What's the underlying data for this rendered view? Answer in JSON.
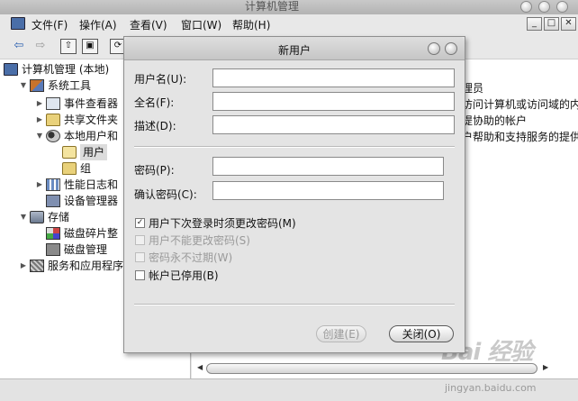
{
  "window": {
    "title": "计算机管理",
    "controls": [
      "_",
      "□",
      "✕"
    ]
  },
  "menu": [
    {
      "label": "文件(F)"
    },
    {
      "label": "操作(A)"
    },
    {
      "label": "查看(V)"
    },
    {
      "label": "窗口(W)"
    },
    {
      "label": "帮助(H)"
    }
  ],
  "toolbar": {
    "back": "⇦",
    "forward": "⇨",
    "up": "⇧",
    "showhide": "▣",
    "refresh": "⟳"
  },
  "tree": {
    "items": [
      {
        "label": "计算机管理 (本地)",
        "expander": ""
      },
      {
        "label": "系统工具",
        "expander": "▼"
      },
      {
        "label": "事件查看器",
        "expander": "▶"
      },
      {
        "label": "共享文件夹",
        "expander": "▶"
      },
      {
        "label": "本地用户和",
        "expander": "▼"
      },
      {
        "label": "用户",
        "expander": ""
      },
      {
        "label": "组",
        "expander": ""
      },
      {
        "label": "性能日志和",
        "expander": "▶"
      },
      {
        "label": "设备管理器",
        "expander": ""
      },
      {
        "label": "存储",
        "expander": "▼"
      },
      {
        "label": "磁盘碎片整",
        "expander": ""
      },
      {
        "label": "磁盘管理",
        "expander": ""
      },
      {
        "label": "服务和应用程序",
        "expander": "▶"
      }
    ]
  },
  "right_pane": {
    "lines": [
      "理员",
      "访问计算机或访问域的内",
      "提协助的帐户",
      "户帮助和支持服务的提供"
    ]
  },
  "dialog": {
    "title": "新用户",
    "username_label": "用户名(U):",
    "username_value": "",
    "fullname_label": "全名(F):",
    "fullname_value": "",
    "desc_label": "描述(D):",
    "desc_value": "",
    "password_label": "密码(P):",
    "password_value": "",
    "confirm_label": "确认密码(C):",
    "confirm_value": "",
    "checkboxes": [
      {
        "label": "用户下次登录时须更改密码(M)",
        "checked": true,
        "enabled": true
      },
      {
        "label": "用户不能更改密码(S)",
        "checked": false,
        "enabled": false
      },
      {
        "label": "密码永不过期(W)",
        "checked": false,
        "enabled": false
      },
      {
        "label": "帐户已停用(B)",
        "checked": false,
        "enabled": true
      }
    ],
    "create_button": "创建(E)",
    "close_button": "关闭(O)"
  },
  "watermark": {
    "text": "Bai 经验",
    "url": "jingyan.baidu.com"
  }
}
